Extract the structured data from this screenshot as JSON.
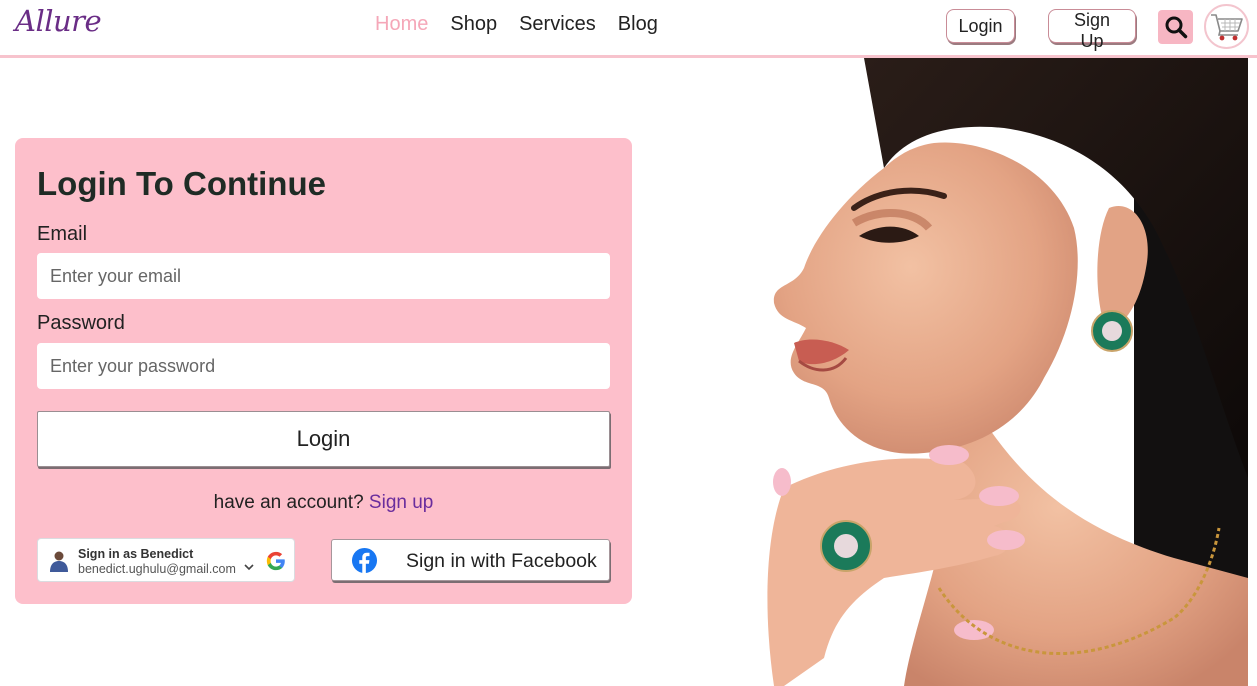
{
  "brand": {
    "logo_text": "Allure"
  },
  "nav": {
    "links": [
      {
        "label": "Home",
        "active": true
      },
      {
        "label": "Shop",
        "active": false
      },
      {
        "label": "Services",
        "active": false
      },
      {
        "label": "Blog",
        "active": false
      }
    ],
    "login_label": "Login",
    "signup_label": "Sign Up",
    "search_icon": "search-icon",
    "cart_icon": "shopping-cart-icon"
  },
  "login_form": {
    "title": "Login To Continue",
    "email_label": "Email",
    "email_placeholder": "Enter your email",
    "email_value": "",
    "password_label": "Password",
    "password_placeholder": "Enter your password",
    "password_value": "",
    "submit_label": "Login",
    "signup_prompt": "have an account?",
    "signup_link": "Sign up",
    "google": {
      "name_text": "Sign in as Benedict",
      "email_text": "benedict.ughulu@gmail.com"
    },
    "facebook_label": "Sign in with Facebook"
  },
  "colors": {
    "brand": "#6a2d86",
    "accent_pink": "#fdbfcb",
    "nav_active": "#f5a7b8",
    "link_purple": "#6a2d9d",
    "facebook_blue": "#1877f2"
  }
}
